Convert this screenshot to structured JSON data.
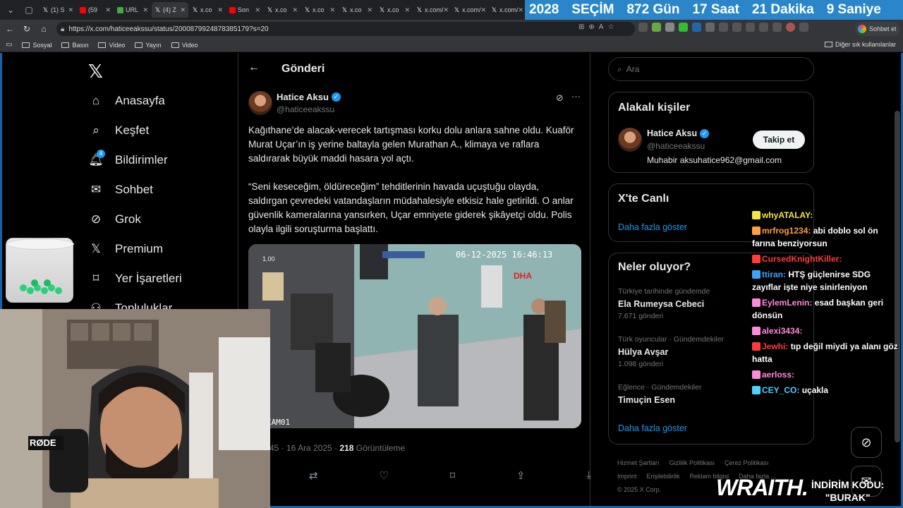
{
  "browser": {
    "tabs": [
      {
        "label": "(1) S",
        "icon": "x-icon"
      },
      {
        "label": "(59",
        "icon": "youtube-icon"
      },
      {
        "label": "URL",
        "icon": "url-icon"
      },
      {
        "label": "(4) Z",
        "icon": "x-icon"
      },
      {
        "label": "x.co",
        "icon": "x-icon"
      },
      {
        "label": "Son",
        "icon": "youtube-icon"
      },
      {
        "label": "x.co",
        "icon": "x-icon"
      },
      {
        "label": "x.co",
        "icon": "x-icon"
      },
      {
        "label": "x.co",
        "icon": "x-icon"
      },
      {
        "label": "x.co",
        "icon": "x-icon"
      },
      {
        "label": "x.com/",
        "icon": "x-icon"
      },
      {
        "label": "x.com/",
        "icon": "x-icon"
      },
      {
        "label": "x.com/",
        "icon": "x-icon"
      }
    ],
    "url": "https://x.com/haticeeakssu/status/2000879924878385179?s=20",
    "copilot_label": "Sohbet et",
    "bookmarks": [
      "Sosyal",
      "Basın",
      "Video",
      "Yayın",
      "Video"
    ],
    "other_bookmarks": "Diğer sık kullanılanlar"
  },
  "countdown": {
    "year": "2028",
    "label": "SEÇİM",
    "days": "872 Gün",
    "hours": "17 Saat",
    "minutes": "21 Dakika",
    "seconds": "9 Saniye"
  },
  "sidebar": {
    "items": [
      {
        "label": "Anasayfa",
        "icon": "home-icon"
      },
      {
        "label": "Keşfet",
        "icon": "search-icon"
      },
      {
        "label": "Bildirimler",
        "icon": "bell-icon",
        "badge": "4"
      },
      {
        "label": "Sohbet",
        "icon": "mail-icon"
      },
      {
        "label": "Grok",
        "icon": "grok-icon"
      },
      {
        "label": "Premium",
        "icon": "x-icon"
      },
      {
        "label": "Yer İşaretleri",
        "icon": "bookmark-icon"
      },
      {
        "label": "Topluluklar",
        "icon": "people-icon"
      }
    ]
  },
  "post": {
    "header_title": "Gönderi",
    "author_name": "Hatice Aksu",
    "author_handle": "@haticeeakssu",
    "paragraph_1": "Kağıthane’de alacak-verecek tartışması korku dolu anlara sahne oldu. Kuaför Murat Uçar’ın iş yerine baltayla gelen Murathan A., klimaya ve raflara saldırarak büyük maddi hasara yol açtı.",
    "paragraph_2": "“Seni keseceğim, öldüreceğim” tehditlerinin havada uçuştuğu olayda, saldırgan çevredeki vatandaşların müdahalesiyle etkisiz hale getirildi. O anlar güvenlik kameralarına yansırken, Uçar emniyete giderek şikâyetçi oldu. Polis olayla ilgili soruşturma başlattı.",
    "video_timestamp": "06-12-2025 16:46:13",
    "video_speed": "1.00",
    "video_watermark": "DHA",
    "video_camera": "CAM01",
    "time": "45 · 16 Ara 2025 · ",
    "views_count": "218",
    "views_label": "Görüntüleme"
  },
  "right": {
    "search_placeholder": "Ara",
    "related": {
      "title": "Alakalı kişiler",
      "name": "Hatice Aksu",
      "handle": "@haticeeakssu",
      "bio": "Muhabir aksuhatice962@gmail.com",
      "follow": "Takip et"
    },
    "live": {
      "title": "X'te Canlı",
      "more": "Daha fazla göster"
    },
    "trends": {
      "title": "Neler oluyor?",
      "items": [
        {
          "category": "Türkiye tarihinde gündemde",
          "name": "Ela Rumeysa Cebeci",
          "count": "7.671 gönderi"
        },
        {
          "category": "Türk oyuncular · Gündemdekiler",
          "name": "Hülya Avşar",
          "count": "1.098 gönderi"
        },
        {
          "category": "Eğlence · Gündemdekiler",
          "name": "Timuçin Esen",
          "count": ""
        }
      ],
      "more": "Daha fazla göster"
    },
    "footer": [
      "Hizmet Şartları",
      "Gizlilik Politikası",
      "Çerez Politikası",
      "Imprint",
      "Erişilebilirlik",
      "Reklam bilgisi",
      "Daha fazla ...",
      "© 2025 X Corp."
    ]
  },
  "chat": [
    {
      "user": "whyATALAY:",
      "msg": "",
      "color": "#f5e642"
    },
    {
      "user": "mrfrog1234:",
      "msg": "abi doblo sol ön farına benziyorsun",
      "color": "#ff9e3d"
    },
    {
      "user": "CursedKnightKiller:",
      "msg": "",
      "color": "#ff3b3b"
    },
    {
      "user": "ttiran:",
      "msg": "HTŞ güçlenirse SDG zayıflar işte niye sinirleniyon",
      "color": "#3da5ff"
    },
    {
      "user": "EylemLenin:",
      "msg": "esad başkan geri dönsün",
      "color": "#ff8ad8"
    },
    {
      "user": "alexi3434:",
      "msg": "",
      "color": "#ff8ad8"
    },
    {
      "user": "Jewhi:",
      "msg": "tıp değil miydi ya alanı göz hatta",
      "color": "#ff3b3b"
    },
    {
      "user": "aerloss:",
      "msg": "",
      "color": "#ff8ad8"
    },
    {
      "user": "CEY_CO:",
      "msg": "uçakla",
      "color": "#4dd2ff"
    }
  ],
  "overlay": {
    "brand": "WRAITH.",
    "promo_line1": "İNDİRİM KODU:",
    "promo_line2": "\"BURAK\""
  },
  "colors": {
    "accent": "#1d9bf0",
    "countdown_bg": "#2a86c9",
    "frame": "#1c5fa8"
  }
}
